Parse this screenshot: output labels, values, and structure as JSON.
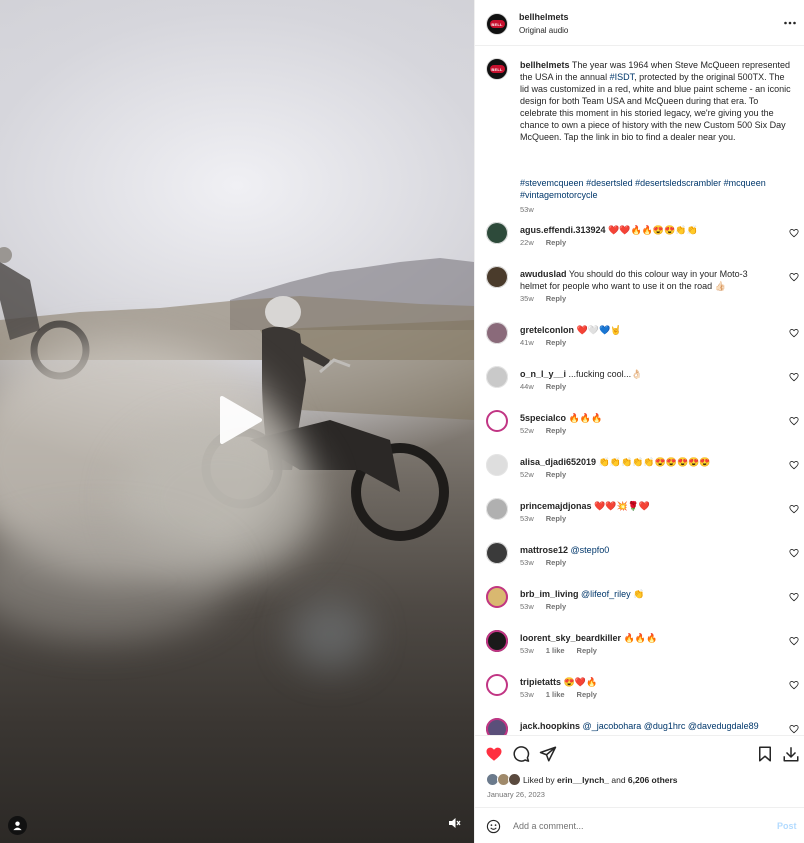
{
  "post": {
    "username": "bellhelmets",
    "audio": "Original audio",
    "caption_user": "bellhelmets",
    "caption_before_tag": " The year was 1964 when Steve McQueen represented the USA in the annual ",
    "caption_tag_inline": "#ISDT",
    "caption_after_tag": ", protected by the original 500TX. The lid was customized in a red, white and blue paint scheme - an iconic design for both Team USA and McQueen during that era. To celebrate this moment in his storied legacy, we're giving you the chance to own a piece of history with the new Custom 500 Six Day McQueen. Tap the link in bio to find a dealer near you.",
    "hashtags": [
      "#stevemcqueen",
      "#desertsled",
      "#desertsledscrambler",
      "#mcqueen",
      "#vintagemotorcycle"
    ],
    "caption_time": "53w",
    "logo_text": "BELL"
  },
  "comments": [
    {
      "user": "agus.effendi.313924",
      "text": "❤️❤️🔥🔥😍😍👏👏",
      "mention": "",
      "time": "22w",
      "likes": "",
      "reply": "Reply"
    },
    {
      "user": "awuduslad",
      "text": "You should do this colour way in your Moto-3 helmet for people who want to use it on the road 👍🏻",
      "mention": "",
      "time": "35w",
      "likes": "",
      "reply": "Reply"
    },
    {
      "user": "gretelconlon",
      "text": "❤️🤍💙🤘",
      "mention": "",
      "time": "41w",
      "likes": "",
      "reply": "Reply"
    },
    {
      "user": "o_n_l_y__i",
      "text": "...fucking cool...👌🏻",
      "mention": "",
      "time": "44w",
      "likes": "",
      "reply": "Reply"
    },
    {
      "user": "5specialco",
      "text": "🔥🔥🔥",
      "mention": "",
      "time": "52w",
      "likes": "",
      "reply": "Reply"
    },
    {
      "user": "alisa_djadi652019",
      "text": "👏👏👏👏👏😍😍😍😍😍",
      "mention": "",
      "time": "52w",
      "likes": "",
      "reply": "Reply"
    },
    {
      "user": "princemajdjonas",
      "text": "❤️❤️💥🌹❤️",
      "mention": "",
      "time": "53w",
      "likes": "",
      "reply": "Reply"
    },
    {
      "user": "mattrose12",
      "text": "",
      "mention": "@stepfo0",
      "time": "53w",
      "likes": "",
      "reply": "Reply"
    },
    {
      "user": "brb_im_living",
      "text": " 👏",
      "mention": "@lifeof_riley",
      "time": "53w",
      "likes": "",
      "reply": "Reply"
    },
    {
      "user": "loorent_sky_beardkiller",
      "text": "🔥🔥🔥",
      "mention": "",
      "time": "53w",
      "likes": "1 like",
      "reply": "Reply"
    },
    {
      "user": "tripietatts",
      "text": "😍❤️🔥",
      "mention": "",
      "time": "53w",
      "likes": "1 like",
      "reply": "Reply"
    },
    {
      "user": "jack.hoopkins",
      "text": "",
      "mention": "@_jacobohara @dug1hrc @davedugdale89",
      "time": "",
      "likes": "",
      "reply": ""
    }
  ],
  "actions": {
    "liked_prefix": "Liked by ",
    "liked_user": "erin__lynch_",
    "liked_mid": " and ",
    "liked_count": "6,206 others",
    "date": "January 26, 2023"
  },
  "composer": {
    "placeholder": "Add a comment...",
    "post_label": "Post"
  },
  "colors": {
    "like_red": "#ff3040",
    "link_blue": "#00376b",
    "post_disabled": "#b3dbff"
  }
}
